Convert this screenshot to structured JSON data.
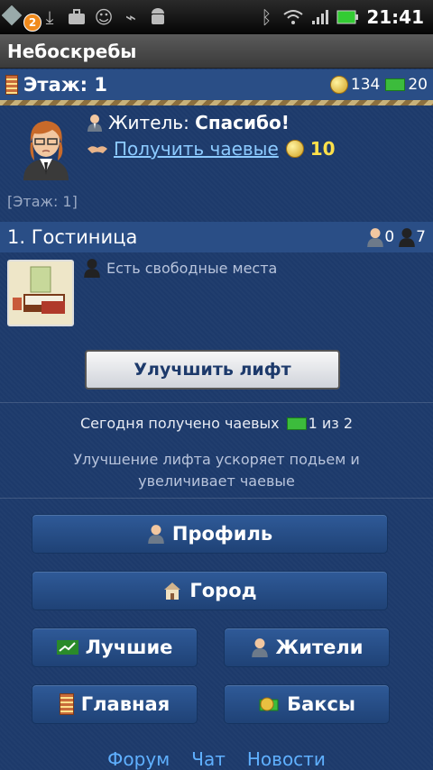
{
  "statusbar": {
    "notification_count": "2",
    "time": "21:41",
    "icons": [
      "app-notification-icon",
      "download-icon",
      "briefcase-icon",
      "smiley-icon",
      "usb-icon",
      "android-icon",
      "bluetooth-icon",
      "wifi-icon",
      "signal-icon",
      "battery-icon"
    ]
  },
  "titlebar": {
    "title": "Небоскребы"
  },
  "floor": {
    "label": "Этаж: 1",
    "coins": "134",
    "bucks": "20"
  },
  "resident": {
    "label": "Житель:",
    "message": "Спасибо!",
    "tips_link": "Получить чаевые",
    "tips_amount": "10"
  },
  "floor_note": "[Этаж: 1]",
  "hotel": {
    "title": "1. Гостиница",
    "residents_count": "0",
    "visitors_count": "7",
    "status": "Есть свободные места"
  },
  "elevator_button": "Улучшить лифт",
  "today_tips": {
    "prefix": "Сегодня получено чаевых",
    "value": "1 из 2"
  },
  "hint": "Улучшение лифта ускоряет подьем и увеличивает чаевые",
  "nav": {
    "profile": "Профиль",
    "city": "Город",
    "best": "Лучшие",
    "residents": "Жители",
    "main": "Главная",
    "bucks": "Баксы"
  },
  "footer": {
    "forum": "Форум",
    "chat": "Чат",
    "news": "Новости"
  },
  "colors": {
    "background": "#1d3a6b",
    "bar": "#2a4e86",
    "link": "#8ccaff",
    "coin": "#ffe04a"
  }
}
